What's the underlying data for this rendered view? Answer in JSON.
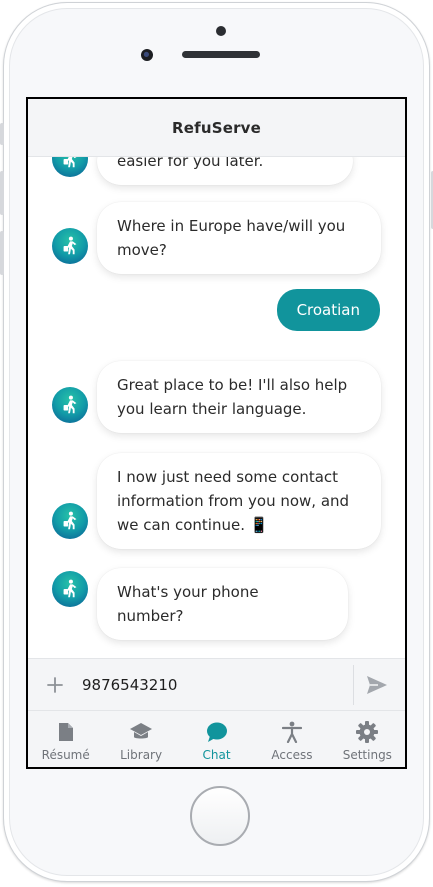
{
  "app": {
    "title": "RefuServe"
  },
  "colors": {
    "accent": "#11949c",
    "avatar_gradient_start": "#27c1a8",
    "avatar_gradient_end": "#0a5a93",
    "tab_inactive": "#6f7379"
  },
  "messages": [
    {
      "sender": "bot",
      "text": "easier for you later."
    },
    {
      "sender": "bot",
      "lines": [
        "Where in Europe have/will you",
        "move?"
      ]
    },
    {
      "sender": "user",
      "text": "Croatian"
    },
    {
      "sender": "bot",
      "lines": [
        "Great place to be! I'll also help",
        "you learn their language."
      ]
    },
    {
      "sender": "bot",
      "lines": [
        "I now just need some contact",
        "information from you now, and",
        "we can continue. 📱"
      ]
    },
    {
      "sender": "bot",
      "text": "What's your phone number?"
    }
  ],
  "composer": {
    "add_icon": "plus-icon",
    "value": "9876543210",
    "send_icon": "send-icon"
  },
  "tabs": [
    {
      "label": "Résumé",
      "icon": "document-icon",
      "active": false
    },
    {
      "label": "Library",
      "icon": "graduation-cap-icon",
      "active": false
    },
    {
      "label": "Chat",
      "icon": "chat-bubble-icon",
      "active": true
    },
    {
      "label": "Access",
      "icon": "accessibility-icon",
      "active": false
    },
    {
      "label": "Settings",
      "icon": "gear-icon",
      "active": false
    }
  ]
}
